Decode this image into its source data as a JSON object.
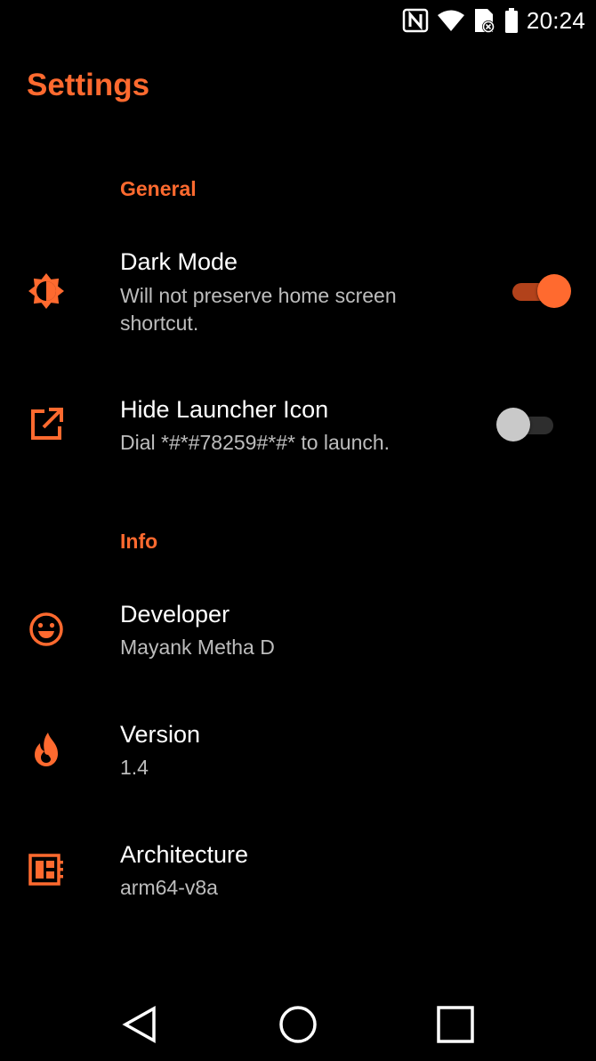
{
  "status_bar": {
    "time": "20:24",
    "icons": [
      "nfc-icon",
      "wifi-icon",
      "no-sim-icon",
      "battery-icon"
    ]
  },
  "header": {
    "title": "Settings"
  },
  "sections": [
    {
      "header": "General",
      "items": [
        {
          "icon": "brightness-icon",
          "title": "Dark Mode",
          "summary": "Will not preserve home screen shortcut.",
          "toggle": true
        },
        {
          "icon": "open-external-icon",
          "title": "Hide Launcher Icon",
          "summary": "Dial *#*#78259#*#* to launch.",
          "toggle": false
        }
      ]
    },
    {
      "header": "Info",
      "items": [
        {
          "icon": "smiley-icon",
          "title": "Developer",
          "summary": "Mayank Metha D"
        },
        {
          "icon": "flame-icon",
          "title": "Version",
          "summary": "1.4"
        },
        {
          "icon": "chip-icon",
          "title": "Architecture",
          "summary": "arm64-v8a"
        }
      ]
    }
  ],
  "nav_bar": {
    "buttons": [
      "back-icon",
      "home-icon",
      "recents-icon"
    ]
  },
  "colors": {
    "accent": "#ff6a2f",
    "background": "#000000",
    "secondary_text": "#bdbdbd"
  }
}
